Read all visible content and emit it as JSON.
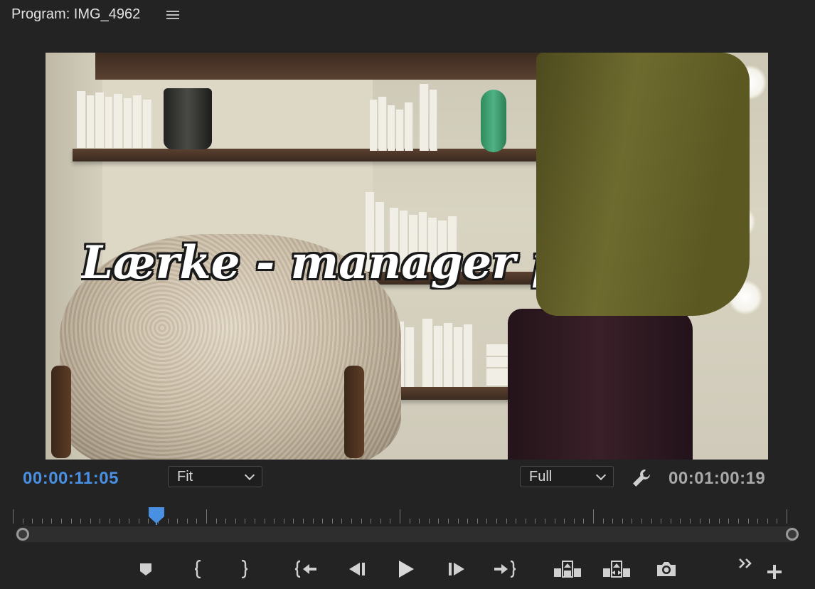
{
  "panel": {
    "title": "Program: IMG_4962",
    "menu_icon": "hamburger-menu-icon"
  },
  "viewer": {
    "title_overlay": "Lærke - manager på"
  },
  "transport": {
    "current_timecode": "00:00:11:05",
    "duration_timecode": "00:01:00:19",
    "zoom_select": {
      "value": "Fit"
    },
    "quality_select": {
      "value": "Full"
    },
    "playhead_position_fraction": 0.185
  },
  "buttons": [
    {
      "name": "add-marker-button",
      "icon": "marker-icon"
    },
    {
      "name": "mark-in-button",
      "icon": "mark-in-icon"
    },
    {
      "name": "mark-out-button",
      "icon": "mark-out-icon"
    },
    {
      "name": "go-to-in-button",
      "icon": "go-to-in-icon"
    },
    {
      "name": "step-back-button",
      "icon": "step-back-icon"
    },
    {
      "name": "play-button",
      "icon": "play-icon"
    },
    {
      "name": "step-forward-button",
      "icon": "step-forward-icon"
    },
    {
      "name": "go-to-out-button",
      "icon": "go-to-out-icon"
    },
    {
      "name": "lift-button",
      "icon": "lift-icon"
    },
    {
      "name": "extract-button",
      "icon": "extract-icon"
    },
    {
      "name": "export-frame-button",
      "icon": "camera-icon"
    },
    {
      "name": "more-controls-button",
      "icon": "double-chevron-icon"
    },
    {
      "name": "button-editor-button",
      "icon": "plus-icon"
    }
  ],
  "colors": {
    "background": "#232323",
    "timecode_current": "#4a90e2",
    "timecode_duration": "#a9a9a9",
    "playhead": "#4a90e2"
  }
}
